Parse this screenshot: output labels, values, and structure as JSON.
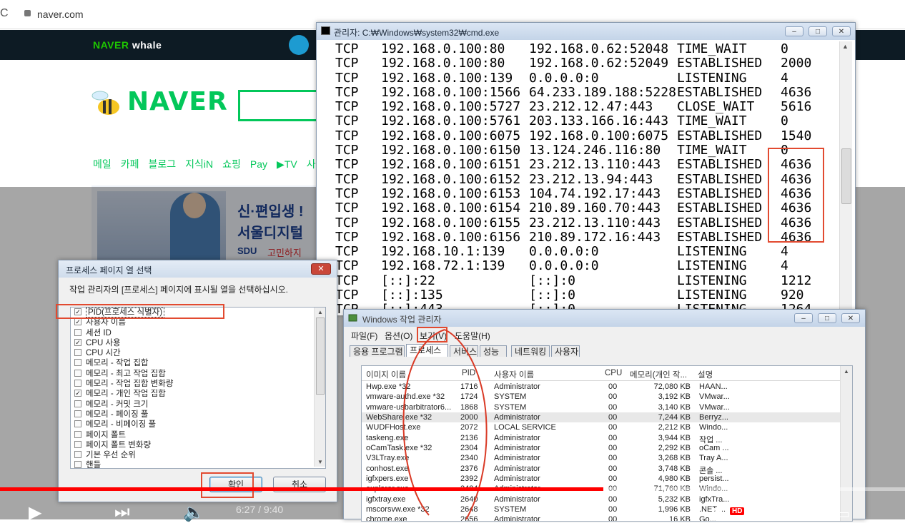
{
  "browser": {
    "url": "naver.com"
  },
  "naver": {
    "whale_brand": "NAVER",
    "whale_brand_suffix": "whale",
    "logo": "NAVER",
    "nav": [
      "메일",
      "카페",
      "블로그",
      "지식iN",
      "쇼핑",
      "Pay",
      "▶TV",
      "사"
    ],
    "banner": {
      "title": "신·편입생 !",
      "subtitle": "서울디지털",
      "brand": "SDU",
      "tagline": "고민하지"
    }
  },
  "cmd": {
    "title": "관리자: C:₩Windows₩system32₩cmd.exe",
    "rows": [
      [
        "TCP",
        "192.168.0.100:80",
        "192.168.0.62:52048",
        "TIME_WAIT",
        "0"
      ],
      [
        "TCP",
        "192.168.0.100:80",
        "192.168.0.62:52049",
        "ESTABLISHED",
        "2000"
      ],
      [
        "TCP",
        "192.168.0.100:139",
        "0.0.0.0:0",
        "LISTENING",
        "4"
      ],
      [
        "TCP",
        "192.168.0.100:1566",
        "64.233.189.188:5228",
        "ESTABLISHED",
        "4636"
      ],
      [
        "TCP",
        "192.168.0.100:5727",
        "23.212.12.47:443",
        "CLOSE_WAIT",
        "5616"
      ],
      [
        "TCP",
        "192.168.0.100:5761",
        "203.133.166.16:443",
        "TIME_WAIT",
        "0"
      ],
      [
        "TCP",
        "192.168.0.100:6075",
        "192.168.0.100:6075",
        "ESTABLISHED",
        "1540"
      ],
      [
        "TCP",
        "192.168.0.100:6150",
        "13.124.246.116:80",
        "TIME_WAIT",
        "0"
      ],
      [
        "TCP",
        "192.168.0.100:6151",
        "23.212.13.110:443",
        "ESTABLISHED",
        "4636"
      ],
      [
        "TCP",
        "192.168.0.100:6152",
        "23.212.13.94:443",
        "ESTABLISHED",
        "4636"
      ],
      [
        "TCP",
        "192.168.0.100:6153",
        "104.74.192.17:443",
        "ESTABLISHED",
        "4636"
      ],
      [
        "TCP",
        "192.168.0.100:6154",
        "210.89.160.70:443",
        "ESTABLISHED",
        "4636"
      ],
      [
        "TCP",
        "192.168.0.100:6155",
        "23.212.13.110:443",
        "ESTABLISHED",
        "4636"
      ],
      [
        "TCP",
        "192.168.0.100:6156",
        "210.89.172.16:443",
        "ESTABLISHED",
        "4636"
      ],
      [
        "TCP",
        "192.168.10.1:139",
        "0.0.0.0:0",
        "LISTENING",
        "4"
      ],
      [
        "TCP",
        "192.168.72.1:139",
        "0.0.0.0:0",
        "LISTENING",
        "4"
      ],
      [
        "TCP",
        "[::]:22",
        "[::]:0",
        "LISTENING",
        "1212"
      ],
      [
        "TCP",
        "[::]:135",
        "[::]:0",
        "LISTENING",
        "920"
      ],
      [
        "TCP",
        "[::]:443",
        "[::]:0",
        "LISTENING",
        "1264"
      ]
    ]
  },
  "column_dialog": {
    "title": "프로세스 페이지 열 선택",
    "description": "작업 관리자의 [프로세스] 페이지에 표시될 열을 선택하십시오.",
    "options": [
      {
        "label": "PID(프로세스 식별자)",
        "checked": true
      },
      {
        "label": "사용자 이름",
        "checked": true
      },
      {
        "label": "세션 ID",
        "checked": false
      },
      {
        "label": "CPU 사용",
        "checked": true
      },
      {
        "label": "CPU 시간",
        "checked": false
      },
      {
        "label": "메모리 - 작업 집합",
        "checked": false
      },
      {
        "label": "메모리 - 최고 작업 집합",
        "checked": false
      },
      {
        "label": "메모리 - 작업 집합 변화량",
        "checked": false
      },
      {
        "label": "메모리 - 개인 작업 집합",
        "checked": true
      },
      {
        "label": "메모리 - 커밋 크기",
        "checked": false
      },
      {
        "label": "메모리 - 페이징 풀",
        "checked": false
      },
      {
        "label": "메모리 - 비페이징 풀",
        "checked": false
      },
      {
        "label": "페이지 폴트",
        "checked": false
      },
      {
        "label": "페이지 폴트 변화량",
        "checked": false
      },
      {
        "label": "기본 우선 순위",
        "checked": false
      },
      {
        "label": "핸들",
        "checked": false
      }
    ],
    "ok_label": "확인",
    "cancel_label": "취소"
  },
  "taskmgr": {
    "title": "Windows 작업 관리자",
    "menu": [
      "파일(F)",
      "옵션(O)",
      "보기(V)",
      "도움말(H)"
    ],
    "tabs": [
      "응용 프로그램",
      "프로세스",
      "서비스",
      "성능",
      "네트워킹",
      "사용자"
    ],
    "active_tab": "프로세스",
    "columns": [
      "이미지 이름",
      "PID",
      "사용자 이름",
      "CPU",
      "메모리(개인 작...",
      "설명"
    ],
    "processes": [
      [
        "Hwp.exe *32",
        "1716",
        "Administrator",
        "00",
        "72,080 KB",
        "HAAN..."
      ],
      [
        "vmware-authd.exe *32",
        "1724",
        "SYSTEM",
        "00",
        "3,192 KB",
        "VMwar..."
      ],
      [
        "vmware-usbarbitrator6...",
        "1868",
        "SYSTEM",
        "00",
        "3,140 KB",
        "VMwar..."
      ],
      [
        "WebShare.exe *32",
        "2000",
        "Administrator",
        "00",
        "7,244 KB",
        "Berryz..."
      ],
      [
        "WUDFHost.exe",
        "2072",
        "LOCAL SERVICE",
        "00",
        "2,212 KB",
        "Windo..."
      ],
      [
        "taskeng.exe",
        "2136",
        "Administrator",
        "00",
        "3,944 KB",
        "작업 ..."
      ],
      [
        "oCamTask.exe *32",
        "2304",
        "Administrator",
        "00",
        "2,292 KB",
        "oCam ..."
      ],
      [
        "V3LTray.exe",
        "2340",
        "Administrator",
        "00",
        "3,268 KB",
        "Tray A..."
      ],
      [
        "conhost.exe",
        "2376",
        "Administrator",
        "00",
        "3,748 KB",
        "콘솔 ..."
      ],
      [
        "igfxpers.exe",
        "2392",
        "Administrator",
        "00",
        "4,980 KB",
        "persist..."
      ],
      [
        "explorer.exe",
        "2484",
        "Administrator",
        "00",
        "71,760 KB",
        "Windo..."
      ],
      [
        "igfxtray.exe",
        "2640",
        "Administrator",
        "00",
        "5,232 KB",
        "igfxTra..."
      ],
      [
        "mscorsvw.exe *32",
        "2648",
        "SYSTEM",
        "00",
        "1,996 KB",
        ".NET ..."
      ],
      [
        "chrome.exe",
        "2656",
        "Administrator",
        "00",
        "16 KB",
        "Go..."
      ]
    ]
  },
  "video": {
    "progress": 0.667,
    "time": "6:27 / 9:40",
    "hd": "HD"
  }
}
